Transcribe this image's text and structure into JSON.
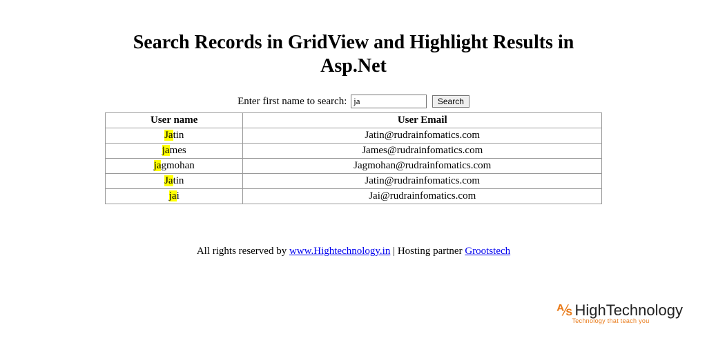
{
  "page": {
    "title": "Search Records in GridView and Highlight Results in Asp.Net"
  },
  "search": {
    "label": "Enter first name to search:",
    "value": "ja",
    "button": "Search"
  },
  "table": {
    "headers": {
      "col0": "User name",
      "col1": "User Email"
    },
    "rows": [
      {
        "name_hl": "Ja",
        "name_rest": "tin",
        "email": "Jatin@rudrainfomatics.com"
      },
      {
        "name_hl": "ja",
        "name_rest": "mes",
        "email": "James@rudrainfomatics.com"
      },
      {
        "name_hl": "ja",
        "name_rest": "gmohan",
        "email": "Jagmohan@rudrainfomatics.com"
      },
      {
        "name_hl": "Ja",
        "name_rest": "tin",
        "email": "Jatin@rudrainfomatics.com"
      },
      {
        "name_hl": "ja",
        "name_rest": "i",
        "email": "Jai@rudrainfomatics.com"
      }
    ]
  },
  "footer": {
    "prefix": "All rights reserved by ",
    "link1": "www.Hightechnology.in",
    "mid": " | Hosting partner ",
    "link2": "Grootstech"
  },
  "logo": {
    "accent": "⅍",
    "main": "HighTechnology",
    "sub": "Technology that teach you"
  }
}
